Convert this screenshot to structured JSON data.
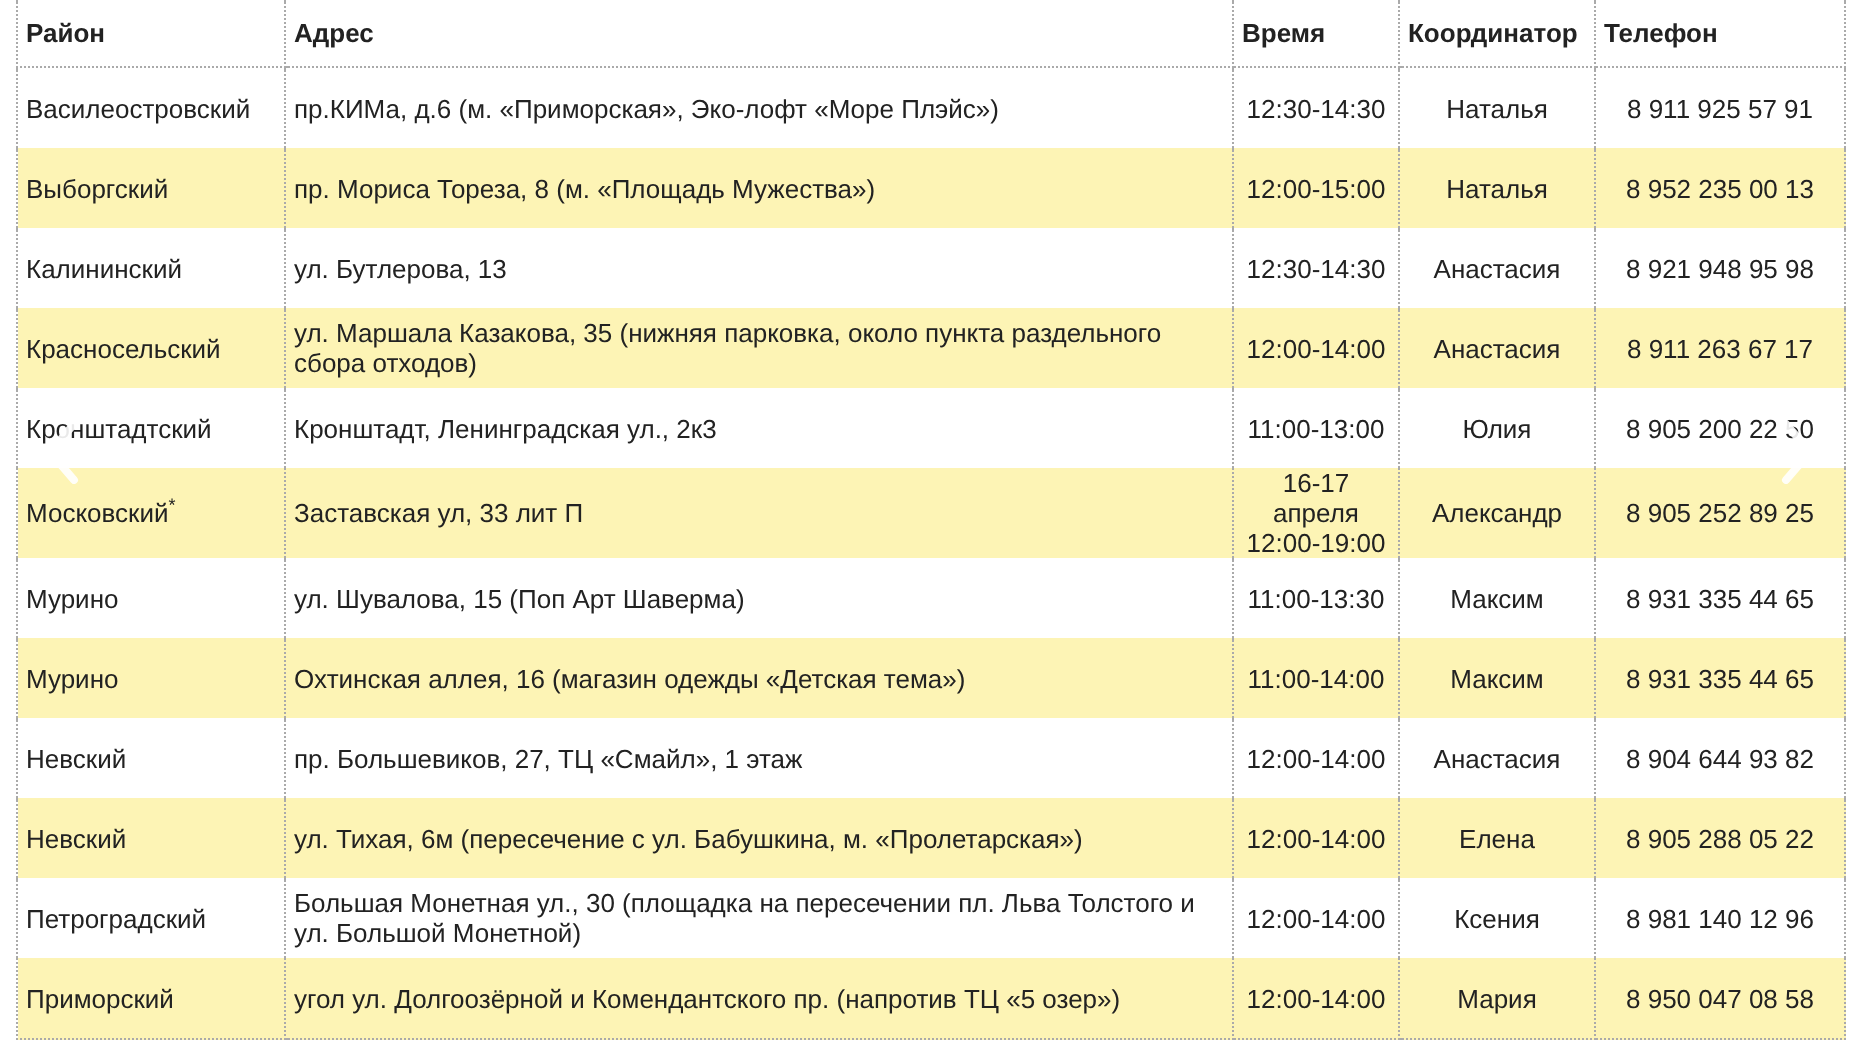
{
  "table": {
    "columns": [
      "Район",
      "Адрес",
      "Время",
      "Координатор",
      "Телефон"
    ],
    "rows": [
      {
        "district": "Василеостровский",
        "address": "пр.КИМа, д.6 (м. «Приморская», Эко-лофт «Море Плэйс»)",
        "time": "12:30-14:30",
        "coordinator": "Наталья",
        "phone": "8 911 925 57 91"
      },
      {
        "district": "Выборгский",
        "address": "пр. Мориса Тореза, 8 (м. «Площадь Мужества»)",
        "time": "12:00-15:00",
        "coordinator": "Наталья",
        "phone": "8 952 235 00 13"
      },
      {
        "district": "Калининский",
        "address": "ул. Бутлерова, 13",
        "time": "12:30-14:30",
        "coordinator": "Анастасия",
        "phone": "8 921 948 95 98"
      },
      {
        "district": "Красносельский",
        "address": "ул. Маршала Казакова, 35 (нижняя парковка, около пункта раздельного сбора отходов)",
        "time": "12:00-14:00",
        "coordinator": "Анастасия",
        "phone": "8 911 263 67 17"
      },
      {
        "district": "Кронштадтский",
        "address": "Кронштадт, Ленинградская ул., 2к3",
        "time": "11:00-13:00",
        "coordinator": "Юлия",
        "phone": "8 905 200 22 50"
      },
      {
        "district": "Московский$^{*}$",
        "address": "Заставская ул, 33 лит П",
        "time": "16-17 апреля 12:00-19:00",
        "coordinator": "Александр",
        "phone": "8 905 252 89 25"
      },
      {
        "district": "Мурино",
        "address": "ул. Шувалова, 15 (Поп Арт Шаверма)",
        "time": "11:00-13:30",
        "coordinator": "Максим",
        "phone": "8 931 335 44 65"
      },
      {
        "district": "Мурино",
        "address": "Охтинская аллея, 16 (магазин одежды «Детская тема»)",
        "time": "11:00-14:00",
        "coordinator": "Максим",
        "phone": "8 931 335 44 65"
      },
      {
        "district": "Невский",
        "address": "пр. Большевиков, 27, ТЦ «Смайл», 1 этаж",
        "time": "12:00-14:00",
        "coordinator": "Анастасия",
        "phone": "8 904 644 93 82"
      },
      {
        "district": "Невский",
        "address": "ул. Тихая, 6м (пересечение с ул. Бабушкина, м. «Пролетарская»)",
        "time": "12:00-14:00",
        "coordinator": "Елена",
        "phone": "8 905 288 05 22"
      },
      {
        "district": "Петроградский",
        "address": "Большая Монетная ул., 30 (площадка на пересечении пл. Льва Толстого и ул. Большой Монетной)",
        "time": "12:00-14:00",
        "coordinator": "Ксения",
        "phone": "8 981 140 12 96"
      },
      {
        "district": "Приморский",
        "address": "угол ул. Долгоозёрной и Комендантского пр. (напротив ТЦ «5 озер»)",
        "time": "12:00-14:00",
        "coordinator": "Мария",
        "phone": "8 950 047 08 58"
      }
    ]
  }
}
